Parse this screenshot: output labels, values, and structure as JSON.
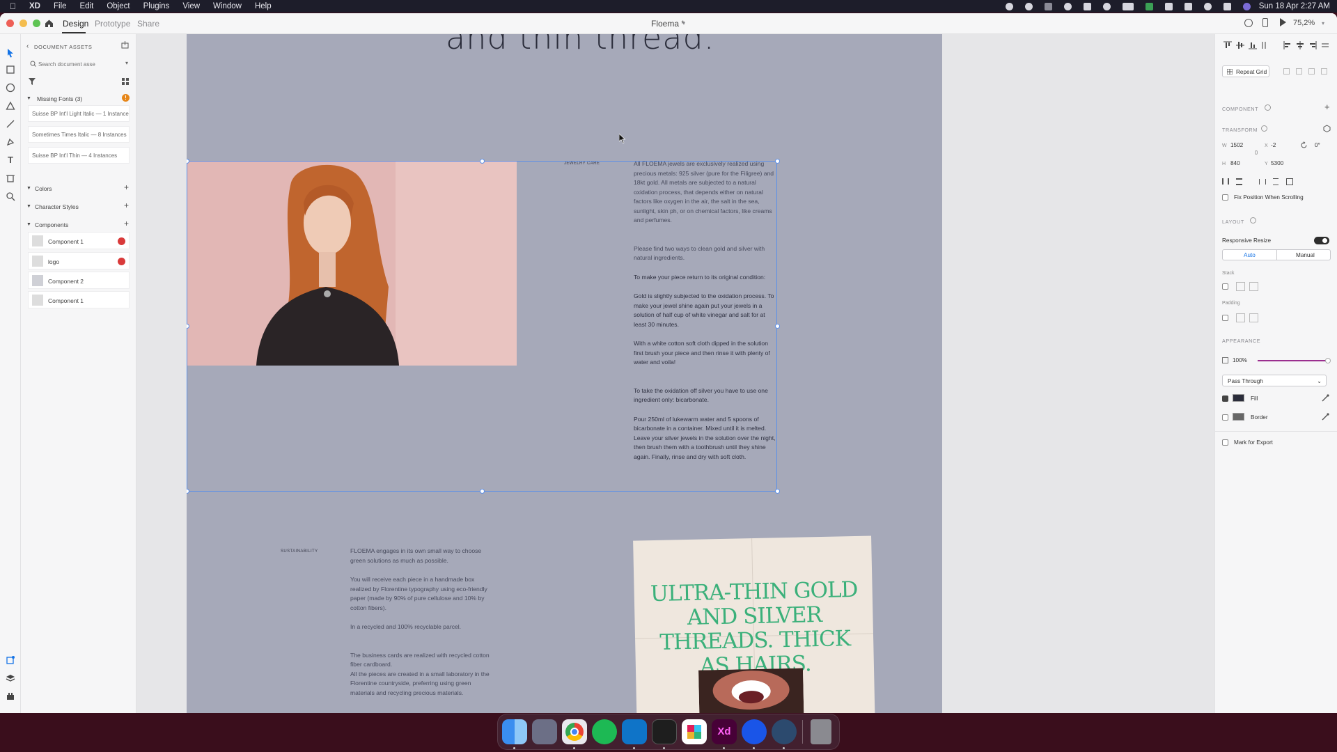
{
  "menubar": {
    "app": "XD",
    "items": [
      "File",
      "Edit",
      "Object",
      "Plugins",
      "View",
      "Window",
      "Help"
    ],
    "zoom": "75,2%",
    "datetime": "Sun 18 Apr 2:27 AM"
  },
  "titlebar": {
    "tabs": [
      "Design",
      "Prototype",
      "Share"
    ],
    "doc_title": "Floema *",
    "zoom": "75,2%"
  },
  "assets": {
    "header": "DOCUMENT ASSETS",
    "search_placeholder": "Search document asse",
    "missing_fonts_label": "Missing Fonts (3)",
    "missing_fonts": [
      "Suisse BP Int'l Light Italic — 1 Instance",
      "Sometimes Times Italic — 8 Instances",
      "Suisse BP Int'l Thin — 4 Instances"
    ],
    "colors_label": "Colors",
    "char_styles_label": "Character Styles",
    "components_label": "Components",
    "components": [
      "Component 1",
      "logo",
      "Component 2",
      "Component 1"
    ]
  },
  "canvas": {
    "headline": "and thin thread.",
    "jewelry_label": "JEWELRY CARE",
    "jewelry_paragraphs": [
      "All FLOEMA jewels are exclusively realized using precious metals: 925 silver (pure for the Filigree) and 18kt gold. All metals are subjected to a natural oxidation process, that depends either on natural factors like oxygen in the air, the salt in the sea, sunlight, skin ph, or on chemical factors, like creams and perfumes.",
      "Please find two ways to clean gold and silver with natural ingredients.",
      "To make your piece return to its original condition:",
      "Gold is slightly subjected to the oxidation process. To make your jewel shine again put your jewels in a solution of half cup of white vinegar and salt for at least 30 minutes.",
      "With a white cotton soft cloth dipped in the solution first brush your piece and then rinse it with plenty of water and voila!",
      "To take the oxidation off silver you have to use one ingredient only: bicarbonate.",
      "Pour 250ml of lukewarm water and 5 spoons of bicarbonate in a container. Mixed until it is melted. Leave your silver jewels in the solution over the night, then brush them with a toothbrush until they shine again. Finally, rinse and dry with soft cloth."
    ],
    "sustainability_label": "SUSTAINABILITY",
    "sustainability_paragraphs": [
      "FLOEMA engages in its own small way to choose green solutions as much as possible.",
      "You will receive each piece in a handmade box realized by Florentine typography using eco-friendly paper (made by 90% of pure cellulose and 10% by cotton fibers).",
      "In a recycled and 100% recyclable parcel.",
      "The business cards are realized with recycled cotton fiber cardboard.",
      "All the pieces are created in a small laboratory in the Florentine countryside, preferring using green materials and recycling precious materials."
    ],
    "poster_text": "ULTRA-THIN GOLD AND SILVER THREADS. THICK AS HAIRS."
  },
  "properties": {
    "repeat_grid": "Repeat Grid",
    "component_cap": "COMPONENT",
    "transform_cap": "TRANSFORM",
    "w_label": "W",
    "w_value": "1502",
    "x_label": "X",
    "x_value": "-2",
    "rotation": "0°",
    "h_label": "H",
    "h_value": "840",
    "y_label": "Y",
    "y_value": "5300",
    "fix_position": "Fix Position When Scrolling",
    "layout_cap": "LAYOUT",
    "responsive_resize": "Responsive Resize",
    "auto": "Auto",
    "manual": "Manual",
    "stack": "Stack",
    "padding": "Padding",
    "appearance_cap": "APPEARANCE",
    "opacity": "100%",
    "opacity_level": 1.0,
    "blend_mode": "Pass Through",
    "fill": "Fill",
    "border": "Border",
    "mark_export": "Mark for Export"
  },
  "colors": {
    "artboard": "#a6a9b9",
    "selection": "#5b8fe8",
    "accent_purple": "#9b2f8f",
    "poster_green": "#3bb07a",
    "fill_swatch": "#2a2c3a",
    "border_swatch": "#666"
  }
}
